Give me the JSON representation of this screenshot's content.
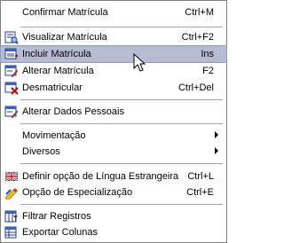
{
  "menu": {
    "items": [
      {
        "label": "Confirmar Matrícula",
        "shortcut": "Ctrl+M",
        "icon": "none"
      },
      {
        "label": "Visualizar Matrícula",
        "shortcut": "Ctrl+F2",
        "icon": "view-document-icon"
      },
      {
        "label": "Incluir Matrícula",
        "shortcut": "Ins",
        "icon": "add-document-icon",
        "highlighted": true
      },
      {
        "label": "Alterar Matrícula",
        "shortcut": "F2",
        "icon": "edit-document-icon"
      },
      {
        "label": "Desmatricular",
        "shortcut": "Ctrl+Del",
        "icon": "remove-document-icon"
      },
      {
        "label": "Alterar Dados Pessoais",
        "shortcut": "",
        "icon": "edit-personal-data-icon"
      },
      {
        "label": "Movimentação",
        "shortcut": "",
        "icon": "none",
        "submenu": true
      },
      {
        "label": "Diversos",
        "shortcut": "",
        "icon": "none",
        "submenu": true
      },
      {
        "label": "Definir opção de Língua Estrangeira",
        "shortcut": "Ctrl+L",
        "icon": "flag-icon"
      },
      {
        "label": "Opção de Especialização",
        "shortcut": "Ctrl+E",
        "icon": "pencil-ruler-icon"
      },
      {
        "label": "Filtrar Registros",
        "shortcut": "",
        "icon": "filter-icon"
      },
      {
        "label": "Exportar Colunas",
        "shortcut": "",
        "icon": "export-columns-icon"
      }
    ]
  },
  "colors": {
    "highlight": "#b6bdd2",
    "border": "#7f7f7f",
    "separator": "#a0a0a0"
  }
}
